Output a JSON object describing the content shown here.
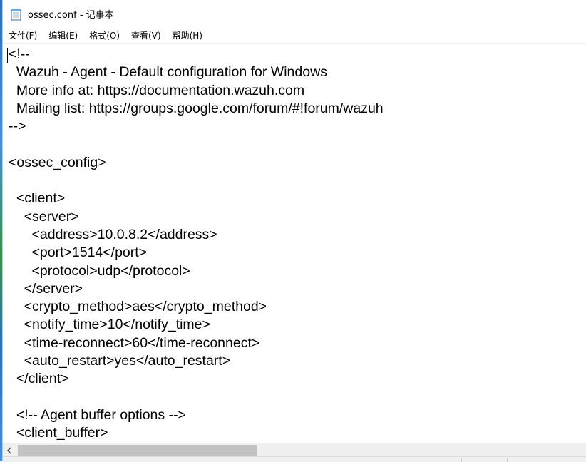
{
  "window": {
    "title": "ossec.conf - 记事本",
    "icon": "notepad-icon"
  },
  "menubar": {
    "items": [
      {
        "label": "文件(F)"
      },
      {
        "label": "编辑(E)"
      },
      {
        "label": "格式(O)"
      },
      {
        "label": "查看(V)"
      },
      {
        "label": "帮助(H)"
      }
    ]
  },
  "editor": {
    "lines": [
      "<!--",
      "  Wazuh - Agent - Default configuration for Windows",
      "  More info at: https://documentation.wazuh.com",
      "  Mailing list: https://groups.google.com/forum/#!forum/wazuh",
      "-->",
      "",
      "<ossec_config>",
      "",
      "  <client>",
      "    <server>",
      "      <address>10.0.8.2</address>",
      "      <port>1514</port>",
      "      <protocol>udp</protocol>",
      "    </server>",
      "    <crypto_method>aes</crypto_method>",
      "    <notify_time>10</notify_time>",
      "    <time-reconnect>60</time-reconnect>",
      "    <auto_restart>yes</auto_restart>",
      "  </client>",
      "",
      "  <!-- Agent buffer options -->",
      "  <client_buffer>"
    ]
  },
  "scrollbar": {
    "left_arrow": "chevron-left-icon"
  }
}
